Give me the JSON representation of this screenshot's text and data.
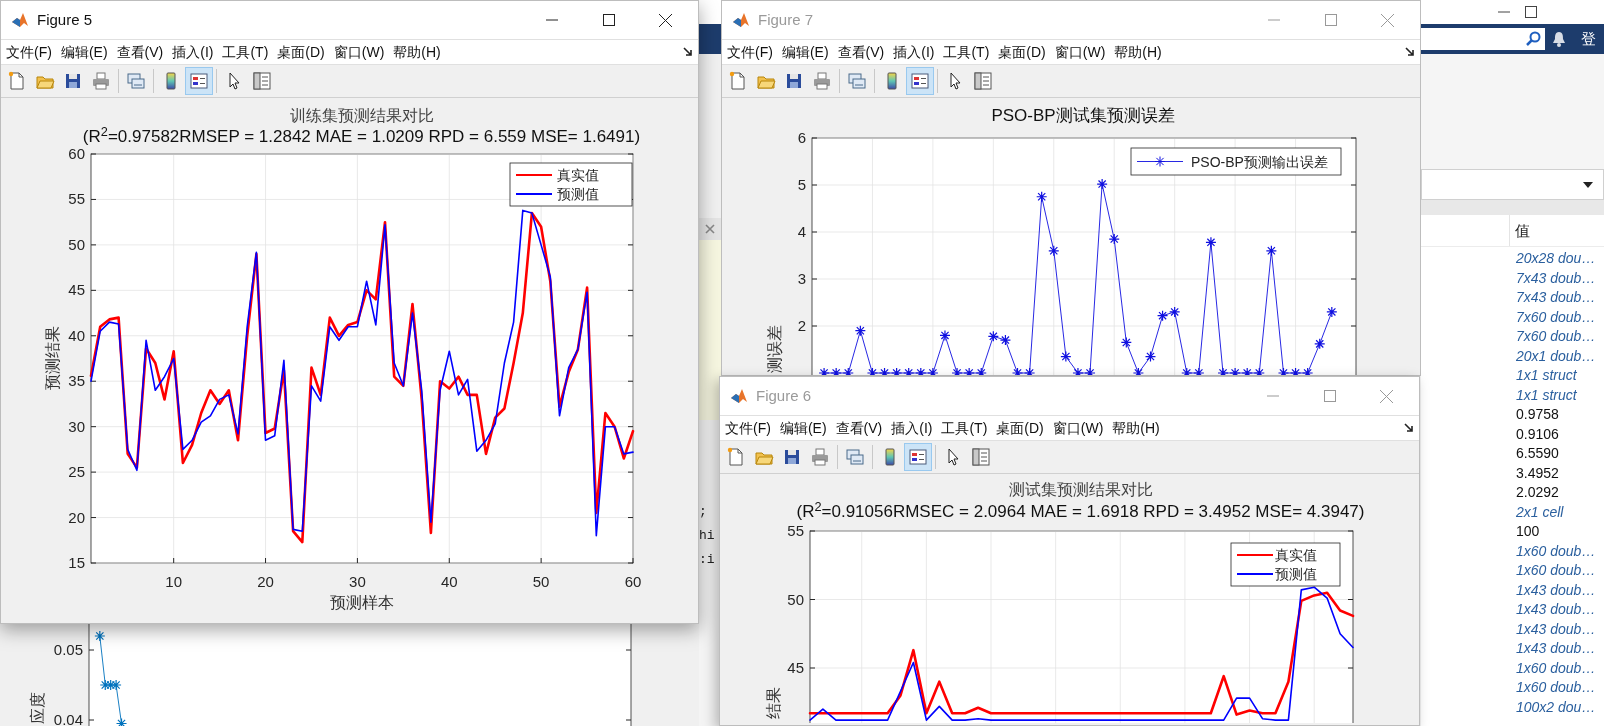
{
  "main_window": {
    "signin_label": "登",
    "editor_lines": [
      ";",
      "hi",
      ":i"
    ],
    "workspace": {
      "column_header": "值",
      "values": [
        {
          "text": "20x28 dou…",
          "kind": "object"
        },
        {
          "text": "7x43 doub…",
          "kind": "object"
        },
        {
          "text": "7x43 doub…",
          "kind": "object"
        },
        {
          "text": "7x60 doub…",
          "kind": "object"
        },
        {
          "text": "7x60 doub…",
          "kind": "object"
        },
        {
          "text": "20x1 doub…",
          "kind": "object"
        },
        {
          "text": "1x1 struct",
          "kind": "object"
        },
        {
          "text": "1x1 struct",
          "kind": "object"
        },
        {
          "text": "0.9758",
          "kind": "number"
        },
        {
          "text": "0.9106",
          "kind": "number"
        },
        {
          "text": "6.5590",
          "kind": "number"
        },
        {
          "text": "3.4952",
          "kind": "number"
        },
        {
          "text": "2.0292",
          "kind": "number"
        },
        {
          "text": "2x1 cell",
          "kind": "object"
        },
        {
          "text": "100",
          "kind": "number"
        },
        {
          "text": "1x60 doub…",
          "kind": "object"
        },
        {
          "text": "1x60 doub…",
          "kind": "object"
        },
        {
          "text": "1x43 doub…",
          "kind": "object"
        },
        {
          "text": "1x43 doub…",
          "kind": "object"
        },
        {
          "text": "1x43 doub…",
          "kind": "object"
        },
        {
          "text": "1x43 doub…",
          "kind": "object"
        },
        {
          "text": "1x60 doub…",
          "kind": "object"
        },
        {
          "text": "1x60 doub…",
          "kind": "object"
        },
        {
          "text": "100x2 dou…",
          "kind": "object"
        }
      ]
    }
  },
  "figures": [
    {
      "kind": "partial",
      "chart_data": {
        "type": "line",
        "grid": false,
        "ylabel": "应度",
        "ylim": [
          0,
          0.1
        ],
        "yticks": [
          0.04,
          0.05
        ],
        "categories": [
          null,
          null,
          null,
          null,
          null
        ],
        "series": [
          {
            "color": "#0072bd",
            "marker": "cross",
            "values": [
              0.052,
              0.045,
              0.045,
              0.045,
              0.0395
            ]
          }
        ]
      }
    },
    {
      "kind": "window",
      "title": "Figure 5",
      "active": true,
      "menu": [
        "文件(F)",
        "编辑(E)",
        "查看(V)",
        "插入(I)",
        "工具(T)",
        "桌面(D)",
        "窗口(W)",
        "帮助(H)"
      ],
      "toolbar": [
        {
          "kind": "new",
          "pressed": false
        },
        {
          "kind": "open",
          "pressed": false
        },
        {
          "kind": "save",
          "pressed": false
        },
        {
          "kind": "print",
          "pressed": false
        },
        {
          "kind": "link",
          "pressed": false
        },
        {
          "kind": "colorbar",
          "pressed": false
        },
        {
          "kind": "legend",
          "pressed": true
        },
        {
          "kind": "pointer",
          "pressed": false
        },
        {
          "kind": "inspector",
          "pressed": false
        }
      ],
      "subtitle": "(R$^{2}$=0.97582RMSEP = 1.2842 MAE = 1.0209 RPD = 6.559 MSE= 1.6491)",
      "chart_data": {
        "type": "line",
        "grid": true,
        "legend": "top right",
        "title": "训练集预测结果对比",
        "xlabel": "预测样本",
        "ylabel": "预测结果",
        "xlim": [
          1,
          60
        ],
        "ylim": [
          15,
          60
        ],
        "xticks": [
          10,
          20,
          30,
          40,
          50,
          60
        ],
        "yticks": [
          15,
          20,
          25,
          30,
          35,
          40,
          45,
          50,
          55,
          60
        ],
        "x": [
          1,
          2,
          3,
          4,
          5,
          6,
          7,
          8,
          9,
          10,
          11,
          12,
          13,
          14,
          15,
          16,
          17,
          18,
          19,
          20,
          21,
          22,
          23,
          24,
          25,
          26,
          27,
          28,
          29,
          30,
          31,
          32,
          33,
          34,
          35,
          36,
          37,
          38,
          39,
          40,
          41,
          42,
          43,
          44,
          45,
          46,
          47,
          48,
          49,
          50,
          51,
          52,
          53,
          54,
          55,
          56,
          57,
          58,
          59,
          60
        ],
        "series": [
          {
            "name": "真实值",
            "color": "#ff0000",
            "marker": "none",
            "values": [
              35.6,
              41,
              41.8,
              42,
              27,
              25.5,
              38.6,
              37,
              33,
              38.3,
              26,
              28,
              31.5,
              34,
              32.5,
              34,
              28.5,
              40,
              49,
              29.3,
              29.8,
              36.2,
              18.5,
              17.3,
              36.5,
              33.5,
              42,
              40,
              41.2,
              41.5,
              45,
              44,
              52.5,
              35.5,
              34.5,
              43.5,
              33,
              18.3,
              35,
              34.2,
              35.5,
              33.5,
              33.5,
              27,
              31,
              32,
              37,
              42.5,
              53.5,
              52,
              46,
              32.2,
              36,
              38.5,
              45.3,
              20.5,
              31.5,
              30,
              26.5,
              29.5
            ]
          },
          {
            "name": "预测值",
            "color": "#0000ff",
            "marker": "none",
            "values": [
              35,
              40.5,
              41.5,
              41.3,
              27.5,
              25.2,
              39.5,
              34,
              35.5,
              37.5,
              27.5,
              28.5,
              30.5,
              31.2,
              33,
              33.5,
              29.2,
              41,
              49.2,
              28.5,
              29,
              37.3,
              18.7,
              18.5,
              34.5,
              32.8,
              41,
              39.5,
              41,
              41,
              46,
              41.2,
              52.2,
              37,
              34.5,
              42.5,
              34,
              19.5,
              34,
              38.3,
              33.5,
              35.2,
              27.3,
              28.5,
              30.3,
              37,
              41.5,
              53.8,
              53.5,
              50,
              46.5,
              31.2,
              36.5,
              38.5,
              44.8,
              18,
              30,
              30,
              27,
              27.2
            ]
          }
        ]
      }
    },
    {
      "kind": "window",
      "title": "Figure 7",
      "active": false,
      "menu": [
        "文件(F)",
        "编辑(E)",
        "查看(V)",
        "插入(I)",
        "工具(T)",
        "桌面(D)",
        "窗口(W)",
        "帮助(H)"
      ],
      "toolbar": [
        {
          "kind": "new",
          "pressed": false
        },
        {
          "kind": "open",
          "pressed": false
        },
        {
          "kind": "save",
          "pressed": false
        },
        {
          "kind": "print",
          "pressed": false
        },
        {
          "kind": "link",
          "pressed": false
        },
        {
          "kind": "colorbar",
          "pressed": false
        },
        {
          "kind": "legend",
          "pressed": true
        },
        {
          "kind": "pointer",
          "pressed": false
        },
        {
          "kind": "inspector",
          "pressed": false
        }
      ],
      "chart_data": {
        "type": "line",
        "grid": true,
        "legend": "top right",
        "title": "PSO-BP测试集预测误差",
        "ylabel": "测误差",
        "ylim": [
          0,
          6
        ],
        "yticks": [
          2,
          3,
          4,
          5,
          6
        ],
        "categories": [
          null,
          null,
          null,
          null,
          null,
          null,
          null,
          null,
          null,
          null,
          null,
          null,
          null,
          null,
          null,
          null,
          null,
          null,
          null,
          null,
          null,
          null,
          null,
          null,
          null,
          null,
          null,
          null,
          null,
          null,
          null,
          null,
          null,
          null,
          null,
          null,
          null,
          null,
          null,
          null,
          null,
          null,
          null
        ],
        "series": [
          {
            "name": "PSO-BP预测输出误差",
            "color": "#1010e0",
            "marker": "cross",
            "values": [
              1.0,
              1.0,
              1.0,
              1.9,
              1.0,
              1.0,
              1.0,
              1.0,
              1.0,
              1.0,
              1.8,
              1.0,
              1.0,
              1.0,
              1.78,
              1.7,
              1.0,
              1.0,
              4.75,
              3.6,
              1.35,
              1.0,
              1.0,
              5.02,
              3.85,
              1.65,
              1.0,
              1.35,
              2.22,
              2.3,
              1.0,
              1.0,
              3.78,
              1.0,
              1.0,
              1.0,
              1.0,
              3.6,
              1.0,
              1.0,
              1.0,
              1.62,
              2.3
            ]
          }
        ]
      }
    },
    {
      "kind": "window",
      "title": "Figure 6",
      "active": false,
      "menu": [
        "文件(F)",
        "编辑(E)",
        "查看(V)",
        "插入(I)",
        "工具(T)",
        "桌面(D)",
        "窗口(W)",
        "帮助(H)"
      ],
      "toolbar": [
        {
          "kind": "new",
          "pressed": false
        },
        {
          "kind": "open",
          "pressed": false
        },
        {
          "kind": "save",
          "pressed": false
        },
        {
          "kind": "print",
          "pressed": false
        },
        {
          "kind": "link",
          "pressed": false
        },
        {
          "kind": "colorbar",
          "pressed": false
        },
        {
          "kind": "legend",
          "pressed": true
        },
        {
          "kind": "pointer",
          "pressed": false
        },
        {
          "kind": "inspector",
          "pressed": false
        }
      ],
      "subtitle": "(R$^{2}$=0.91056RMSEC = 2.0964 MAE = 1.6918 RPD = 3.4952 MSE= 4.3947)",
      "chart_data": {
        "type": "line",
        "grid": true,
        "legend": "top right",
        "title": "测试集预测结果对比",
        "ylabel": "结果",
        "ylim": [
          25,
          55
        ],
        "yticks": [
          45,
          50,
          55
        ],
        "categories": [
          null,
          null,
          null,
          null,
          null,
          null,
          null,
          null,
          null,
          null,
          null,
          null,
          null,
          null,
          null,
          null,
          null,
          null,
          null,
          null,
          null,
          null,
          null,
          null,
          null,
          null,
          null,
          null,
          null,
          null,
          null,
          null,
          null,
          null,
          null,
          null,
          null,
          null,
          null,
          null,
          null,
          null,
          null
        ],
        "series": [
          {
            "name": "真实值",
            "color": "#ff0000",
            "marker": "none",
            "values": [
              41.7,
              41.7,
              41.7,
              41.7,
              41.7,
              41.7,
              41.7,
              43,
              46.3,
              41.7,
              44,
              41.7,
              41.7,
              42.1,
              41.7,
              41.7,
              41.7,
              41.7,
              41.7,
              41.7,
              41.7,
              41.7,
              41.7,
              41.7,
              41.7,
              41.7,
              41.7,
              41.7,
              41.7,
              41.7,
              41.7,
              41.7,
              44.4,
              41.6,
              41.9,
              41.7,
              41.7,
              44,
              49.9,
              50.3,
              50.5,
              49.2,
              48.8
            ]
          },
          {
            "name": "预测值",
            "color": "#0000ff",
            "marker": "none",
            "values": [
              41.2,
              42,
              41.2,
              41.2,
              41.2,
              41.2,
              41.2,
              43.3,
              45.4,
              41.2,
              42.2,
              41.2,
              41.2,
              41.3,
              41.2,
              41.2,
              41.2,
              41.2,
              41.2,
              41.2,
              41.2,
              41.2,
              41.2,
              41.2,
              41.2,
              41.2,
              41.2,
              41.2,
              41.2,
              41.2,
              41.2,
              41.2,
              41.2,
              42.8,
              42.8,
              41.3,
              41.2,
              41.2,
              50.7,
              50.9,
              50.1,
              47.5,
              46.5
            ]
          }
        ]
      }
    }
  ]
}
